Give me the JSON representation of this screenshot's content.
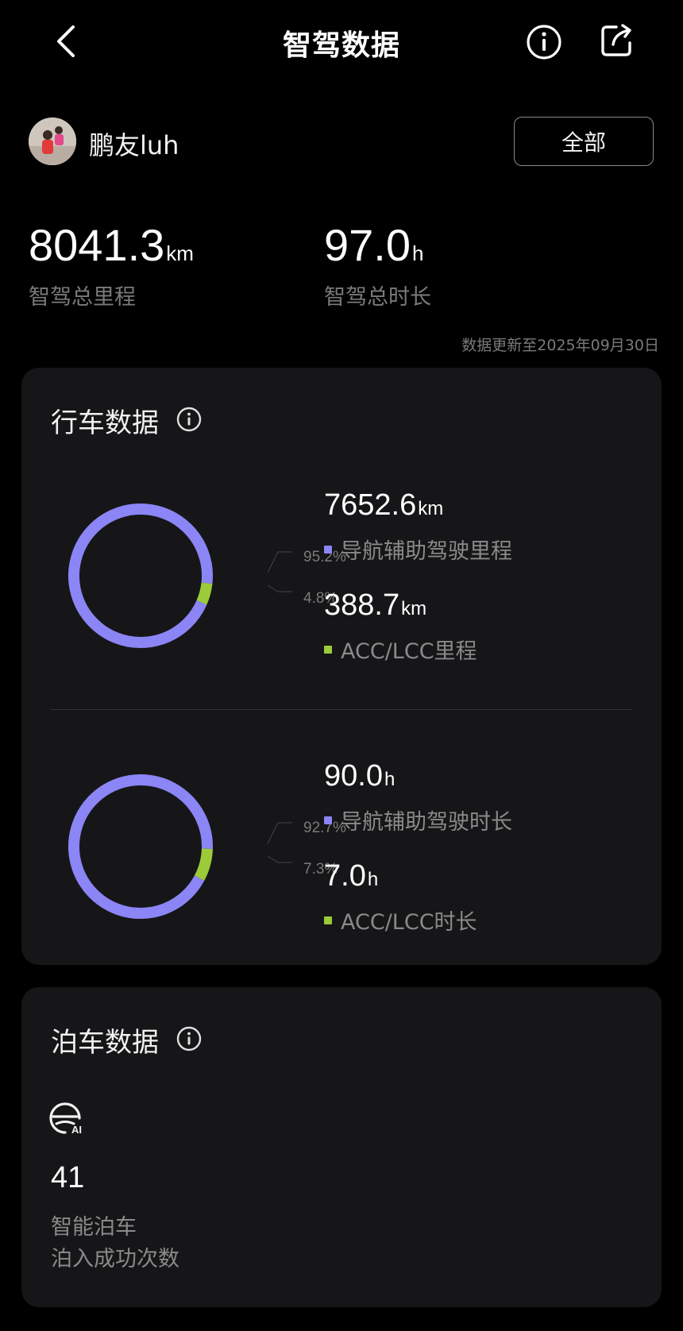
{
  "header": {
    "title": "智驾数据"
  },
  "user": {
    "name": "鹏友luh",
    "filter_label": "全部"
  },
  "totals": {
    "distance": {
      "value": "8041.3",
      "unit": "km",
      "label": "智驾总里程"
    },
    "duration": {
      "value": "97.0",
      "unit": "h",
      "label": "智驾总时长"
    },
    "updated": "数据更新至2025年09月30日"
  },
  "colors": {
    "primary": "#8b85f5",
    "secondary": "#9ccb3a",
    "background": "#000000",
    "card": "#161618"
  },
  "driving": {
    "title": "行车数据",
    "distance_chart": {
      "type": "donut",
      "segments": [
        {
          "label": "导航辅助驾驶里程",
          "value": "7652.6",
          "unit": "km",
          "percent": 95.2,
          "percent_label": "95.2%"
        },
        {
          "label": "ACC/LCC里程",
          "value": "388.7",
          "unit": "km",
          "percent": 4.8,
          "percent_label": "4.8%"
        }
      ]
    },
    "duration_chart": {
      "type": "donut",
      "segments": [
        {
          "label": "导航辅助驾驶时长",
          "value": "90.0",
          "unit": "h",
          "percent": 92.7,
          "percent_label": "92.7%"
        },
        {
          "label": "ACC/LCC时长",
          "value": "7.0",
          "unit": "h",
          "percent": 7.3,
          "percent_label": "7.3%"
        }
      ]
    }
  },
  "parking": {
    "title": "泊车数据",
    "icon": "ai-parking-icon",
    "icon_text": "AI",
    "count": "41",
    "label_line1": "智能泊车",
    "label_line2": "泊入成功次数"
  }
}
